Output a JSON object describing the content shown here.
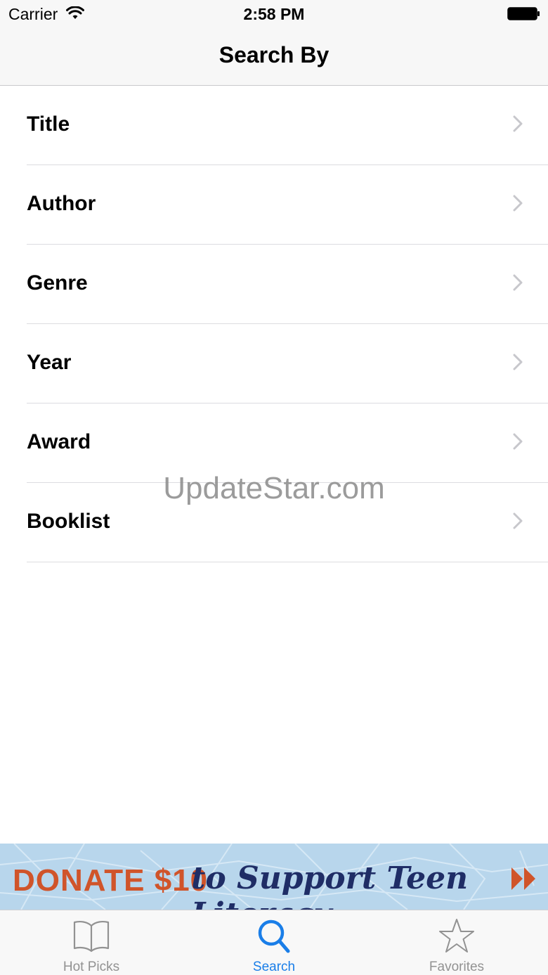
{
  "status_bar": {
    "carrier": "Carrier",
    "time": "2:58 PM"
  },
  "nav": {
    "title": "Search By"
  },
  "search_options": [
    {
      "label": "Title"
    },
    {
      "label": "Author"
    },
    {
      "label": "Genre"
    },
    {
      "label": "Year"
    },
    {
      "label": "Award"
    },
    {
      "label": "Booklist"
    }
  ],
  "watermark": "UpdateStar.com",
  "banner": {
    "amount_text": "DONATE $10",
    "tagline": "to Support Teen Literacy",
    "colors": {
      "background": "#b8d6ec",
      "amount": "#d0542a",
      "tagline": "#1f2d66"
    }
  },
  "tab_bar": {
    "tabs": [
      {
        "label": "Hot Picks",
        "icon": "book-icon",
        "active": false
      },
      {
        "label": "Search",
        "icon": "magnifier-icon",
        "active": true
      },
      {
        "label": "Favorites",
        "icon": "star-icon",
        "active": false
      }
    ],
    "active_color": "#1a7ee8",
    "inactive_color": "#929292"
  }
}
